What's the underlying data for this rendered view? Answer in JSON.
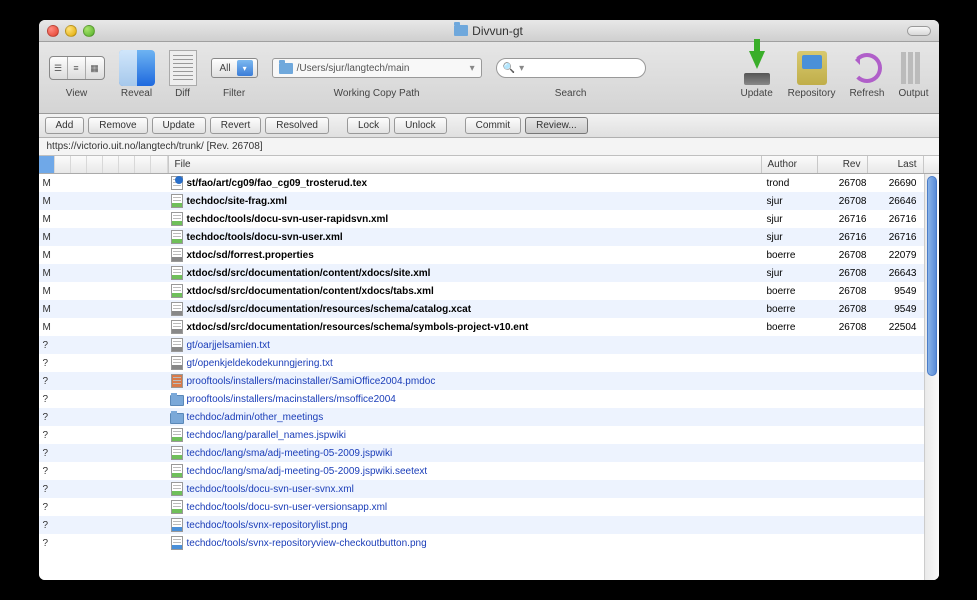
{
  "window": {
    "title": "Divvun-gt"
  },
  "toolbar": {
    "view": "View",
    "reveal": "Reveal",
    "diff": "Diff",
    "filter": "Filter",
    "filter_value": "All",
    "wcpath": "Working Copy Path",
    "wcpath_value": "/Users/sjur/langtech/main",
    "search": "Search",
    "update": "Update",
    "repository": "Repository",
    "refresh": "Refresh",
    "output": "Output"
  },
  "actions": {
    "add": "Add",
    "remove": "Remove",
    "update": "Update",
    "revert": "Revert",
    "resolved": "Resolved",
    "lock": "Lock",
    "unlock": "Unlock",
    "commit": "Commit",
    "review": "Review..."
  },
  "location": "https://victorio.uit.no/langtech/trunk/  [Rev. 26708]",
  "columns": {
    "file": "File",
    "author": "Author",
    "rev": "Rev",
    "last": "Last"
  },
  "rows": [
    {
      "st": "M",
      "icon": "tex",
      "name": "st/fao/art/cg09/fao_cg09_trosterud.tex",
      "link": false,
      "author": "trond",
      "rev": "26708",
      "last": "26690"
    },
    {
      "st": "M",
      "icon": "xml",
      "name": "techdoc/site-frag.xml",
      "link": false,
      "author": "sjur",
      "rev": "26708",
      "last": "26646"
    },
    {
      "st": "M",
      "icon": "xml",
      "name": "techdoc/tools/docu-svn-user-rapidsvn.xml",
      "link": false,
      "author": "sjur",
      "rev": "26716",
      "last": "26716"
    },
    {
      "st": "M",
      "icon": "xml",
      "name": "techdoc/tools/docu-svn-user.xml",
      "link": false,
      "author": "sjur",
      "rev": "26716",
      "last": "26716"
    },
    {
      "st": "M",
      "icon": "txt",
      "name": "xtdoc/sd/forrest.properties",
      "link": false,
      "author": "boerre",
      "rev": "26708",
      "last": "22079"
    },
    {
      "st": "M",
      "icon": "xml",
      "name": "xtdoc/sd/src/documentation/content/xdocs/site.xml",
      "link": false,
      "author": "sjur",
      "rev": "26708",
      "last": "26643"
    },
    {
      "st": "M",
      "icon": "xml",
      "name": "xtdoc/sd/src/documentation/content/xdocs/tabs.xml",
      "link": false,
      "author": "boerre",
      "rev": "26708",
      "last": "9549"
    },
    {
      "st": "M",
      "icon": "txt",
      "name": "xtdoc/sd/src/documentation/resources/schema/catalog.xcat",
      "link": false,
      "author": "boerre",
      "rev": "26708",
      "last": "9549"
    },
    {
      "st": "M",
      "icon": "txt",
      "name": "xtdoc/sd/src/documentation/resources/schema/symbols-project-v10.ent",
      "link": false,
      "author": "boerre",
      "rev": "26708",
      "last": "22504"
    },
    {
      "st": "?",
      "icon": "txt",
      "name": "gt/oarjjelsamien.txt",
      "link": true,
      "author": "",
      "rev": "",
      "last": ""
    },
    {
      "st": "?",
      "icon": "txt",
      "name": "gt/openkjeldekodekunngjering.txt",
      "link": true,
      "author": "",
      "rev": "",
      "last": ""
    },
    {
      "st": "?",
      "icon": "pmdoc",
      "name": "prooftools/installers/macinstaller/SamiOffice2004.pmdoc",
      "link": true,
      "author": "",
      "rev": "",
      "last": ""
    },
    {
      "st": "?",
      "icon": "folder",
      "name": "prooftools/installers/macinstallers/msoffice2004",
      "link": true,
      "author": "",
      "rev": "",
      "last": ""
    },
    {
      "st": "?",
      "icon": "folder",
      "name": "techdoc/admin/other_meetings",
      "link": true,
      "author": "",
      "rev": "",
      "last": ""
    },
    {
      "st": "?",
      "icon": "xml",
      "name": "techdoc/lang/parallel_names.jspwiki",
      "link": true,
      "author": "",
      "rev": "",
      "last": ""
    },
    {
      "st": "?",
      "icon": "xml",
      "name": "techdoc/lang/sma/adj-meeting-05-2009.jspwiki",
      "link": true,
      "author": "",
      "rev": "",
      "last": ""
    },
    {
      "st": "?",
      "icon": "xml",
      "name": "techdoc/lang/sma/adj-meeting-05-2009.jspwiki.seetext",
      "link": true,
      "author": "",
      "rev": "",
      "last": ""
    },
    {
      "st": "?",
      "icon": "xml",
      "name": "techdoc/tools/docu-svn-user-svnx.xml",
      "link": true,
      "author": "",
      "rev": "",
      "last": ""
    },
    {
      "st": "?",
      "icon": "xml",
      "name": "techdoc/tools/docu-svn-user-versionsapp.xml",
      "link": true,
      "author": "",
      "rev": "",
      "last": ""
    },
    {
      "st": "?",
      "icon": "png",
      "name": "techdoc/tools/svnx-repositorylist.png",
      "link": true,
      "author": "",
      "rev": "",
      "last": ""
    },
    {
      "st": "?",
      "icon": "png",
      "name": "techdoc/tools/svnx-repositoryview-checkoutbutton.png",
      "link": true,
      "author": "",
      "rev": "",
      "last": ""
    }
  ]
}
